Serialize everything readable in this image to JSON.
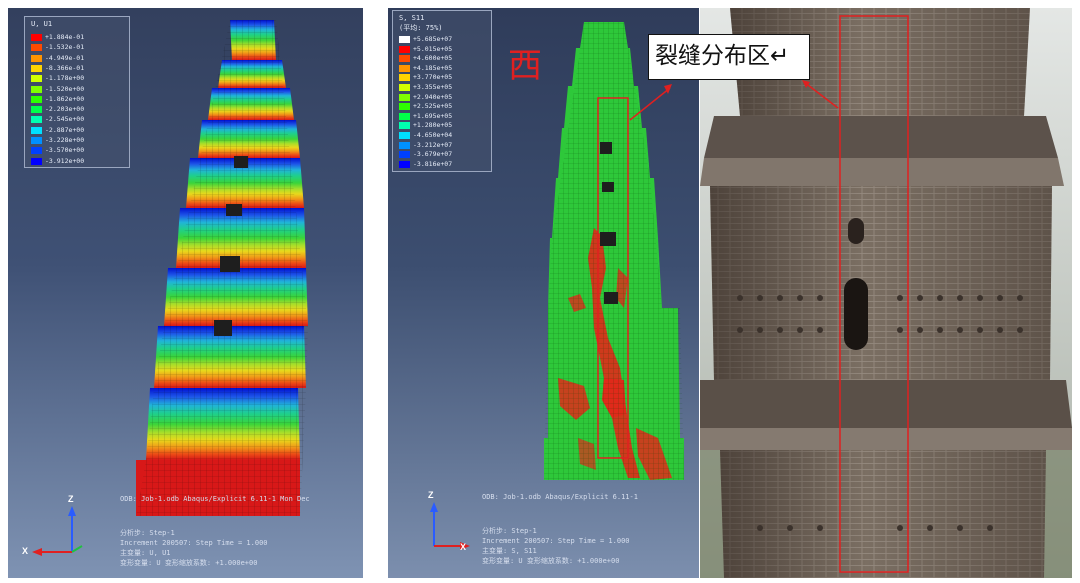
{
  "panel_left": {
    "legend": {
      "title": "U, U1",
      "items": [
        {
          "label": "+1.884e-01",
          "color": "#ff0000"
        },
        {
          "label": "-1.532e-01",
          "color": "#ff4a00"
        },
        {
          "label": "-4.949e-01",
          "color": "#ff9400"
        },
        {
          "label": "-8.366e-01",
          "color": "#ffd400"
        },
        {
          "label": "-1.178e+00",
          "color": "#d2ff00"
        },
        {
          "label": "-1.520e+00",
          "color": "#7fff00"
        },
        {
          "label": "-1.862e+00",
          "color": "#2eff00"
        },
        {
          "label": "-2.203e+00",
          "color": "#00ff4a"
        },
        {
          "label": "-2.545e+00",
          "color": "#00ffb0"
        },
        {
          "label": "-2.887e+00",
          "color": "#00e0ff"
        },
        {
          "label": "-3.228e+00",
          "color": "#0090ff"
        },
        {
          "label": "-3.570e+00",
          "color": "#0040ff"
        },
        {
          "label": "-3.912e+00",
          "color": "#0000ff"
        }
      ]
    },
    "odb_line": "ODB: Job-1.odb    Abaqus/Explicit 6.11-1    Mon Dec",
    "step_line": "分析步: Step-1",
    "increment_line": "Increment   200507: Step Time =    1.000",
    "primary_line": "主变量: U, U1",
    "deformed_line": "变形变量: U  变形缩放系数: +1.000e+00",
    "axis_z": "Z",
    "axis_x": "X"
  },
  "panel_middle": {
    "legend": {
      "title": "S, S11",
      "subtitle": "(平均: 75%)",
      "items": [
        {
          "label": "+5.685e+07",
          "color": "#ffffff"
        },
        {
          "label": "+5.015e+05",
          "color": "#ff0000"
        },
        {
          "label": "+4.600e+05",
          "color": "#ff4a00"
        },
        {
          "label": "+4.185e+05",
          "color": "#ff9400"
        },
        {
          "label": "+3.770e+05",
          "color": "#ffd400"
        },
        {
          "label": "+3.355e+05",
          "color": "#d2ff00"
        },
        {
          "label": "+2.940e+05",
          "color": "#7fff00"
        },
        {
          "label": "+2.525e+05",
          "color": "#2eff00"
        },
        {
          "label": "+1.695e+05",
          "color": "#00ff4a"
        },
        {
          "label": "+1.280e+05",
          "color": "#00ffb0"
        },
        {
          "label": "-4.650e+04",
          "color": "#00e0ff"
        },
        {
          "label": "-3.212e+07",
          "color": "#0090ff"
        },
        {
          "label": "-3.679e+07",
          "color": "#0040ff"
        },
        {
          "label": "-3.816e+07",
          "color": "#0000ff"
        }
      ]
    },
    "direction_char": "西",
    "odb_line": "ODB: Job-1.odb    Abaqus/Explicit 6.11-1",
    "step_line": "分析步: Step-1",
    "increment_line": "Increment   200507: Step Time =    1.000",
    "primary_line": "主变量: S, S11",
    "deformed_line": "变形变量: U  变形缩放系数: +1.000e+00",
    "axis_z": "Z",
    "axis_x": "X"
  },
  "callout": {
    "label": "裂缝分布区↵"
  },
  "colors": {
    "annotation_red": "#e02020",
    "fem_green": "#2ec83a",
    "fem_red": "#e02a1a"
  }
}
